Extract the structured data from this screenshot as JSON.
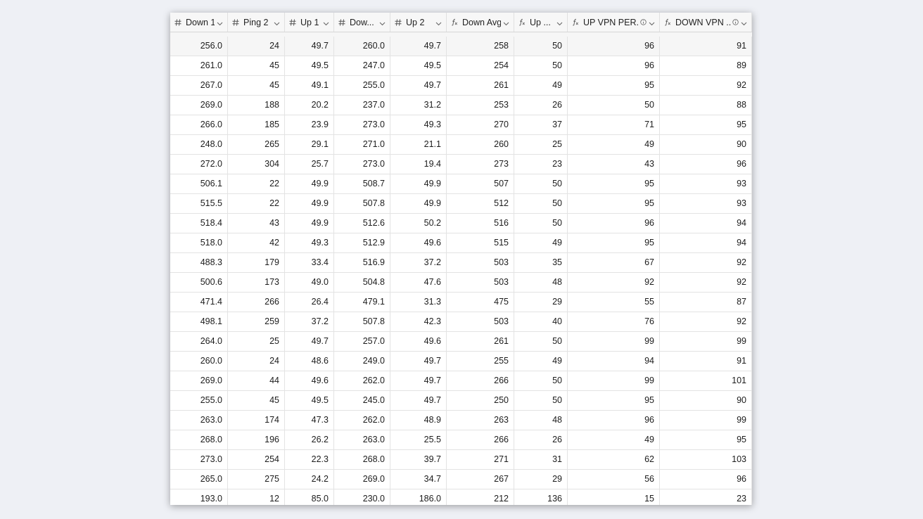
{
  "columns": [
    {
      "label": "Down 1",
      "icon": "hash-icon"
    },
    {
      "label": "Ping 2",
      "icon": "hash-icon"
    },
    {
      "label": "Up 1",
      "icon": "hash-icon"
    },
    {
      "label": "Dow...",
      "icon": "hash-icon"
    },
    {
      "label": "Up 2",
      "icon": "hash-icon"
    },
    {
      "label": "Down Avg",
      "icon": "formula-icon"
    },
    {
      "label": "Up ...",
      "icon": "formula-icon"
    },
    {
      "label": "UP VPN PER...",
      "icon": "formula-icon",
      "info": true
    },
    {
      "label": "DOWN VPN ...",
      "icon": "formula-icon",
      "info": true
    }
  ],
  "rows": [
    [
      "256.0",
      "24",
      "49.7",
      "260.0",
      "49.7",
      "258",
      "50",
      "96",
      "91"
    ],
    [
      "261.0",
      "45",
      "49.5",
      "247.0",
      "49.5",
      "254",
      "50",
      "96",
      "89"
    ],
    [
      "267.0",
      "45",
      "49.1",
      "255.0",
      "49.7",
      "261",
      "49",
      "95",
      "92"
    ],
    [
      "269.0",
      "188",
      "20.2",
      "237.0",
      "31.2",
      "253",
      "26",
      "50",
      "88"
    ],
    [
      "266.0",
      "185",
      "23.9",
      "273.0",
      "49.3",
      "270",
      "37",
      "71",
      "95"
    ],
    [
      "248.0",
      "265",
      "29.1",
      "271.0",
      "21.1",
      "260",
      "25",
      "49",
      "90"
    ],
    [
      "272.0",
      "304",
      "25.7",
      "273.0",
      "19.4",
      "273",
      "23",
      "43",
      "96"
    ],
    [
      "506.1",
      "22",
      "49.9",
      "508.7",
      "49.9",
      "507",
      "50",
      "95",
      "93"
    ],
    [
      "515.5",
      "22",
      "49.9",
      "507.8",
      "49.9",
      "512",
      "50",
      "95",
      "93"
    ],
    [
      "518.4",
      "43",
      "49.9",
      "512.6",
      "50.2",
      "516",
      "50",
      "96",
      "94"
    ],
    [
      "518.0",
      "42",
      "49.3",
      "512.9",
      "49.6",
      "515",
      "49",
      "95",
      "94"
    ],
    [
      "488.3",
      "179",
      "33.4",
      "516.9",
      "37.2",
      "503",
      "35",
      "67",
      "92"
    ],
    [
      "500.6",
      "173",
      "49.0",
      "504.8",
      "47.6",
      "503",
      "48",
      "92",
      "92"
    ],
    [
      "471.4",
      "266",
      "26.4",
      "479.1",
      "31.3",
      "475",
      "29",
      "55",
      "87"
    ],
    [
      "498.1",
      "259",
      "37.2",
      "507.8",
      "42.3",
      "503",
      "40",
      "76",
      "92"
    ],
    [
      "264.0",
      "25",
      "49.7",
      "257.0",
      "49.6",
      "261",
      "50",
      "99",
      "99"
    ],
    [
      "260.0",
      "24",
      "48.6",
      "249.0",
      "49.7",
      "255",
      "49",
      "94",
      "91"
    ],
    [
      "269.0",
      "44",
      "49.6",
      "262.0",
      "49.7",
      "266",
      "50",
      "99",
      "101"
    ],
    [
      "255.0",
      "45",
      "49.5",
      "245.0",
      "49.7",
      "250",
      "50",
      "95",
      "90"
    ],
    [
      "263.0",
      "174",
      "47.3",
      "262.0",
      "48.9",
      "263",
      "48",
      "96",
      "99"
    ],
    [
      "268.0",
      "196",
      "26.2",
      "263.0",
      "25.5",
      "266",
      "26",
      "49",
      "95"
    ],
    [
      "273.0",
      "254",
      "22.3",
      "268.0",
      "39.7",
      "271",
      "31",
      "62",
      "103"
    ],
    [
      "265.0",
      "275",
      "24.2",
      "269.0",
      "34.7",
      "267",
      "29",
      "56",
      "96"
    ],
    [
      "193.0",
      "12",
      "85.0",
      "230.0",
      "186.0",
      "212",
      "136",
      "15",
      "23"
    ]
  ]
}
